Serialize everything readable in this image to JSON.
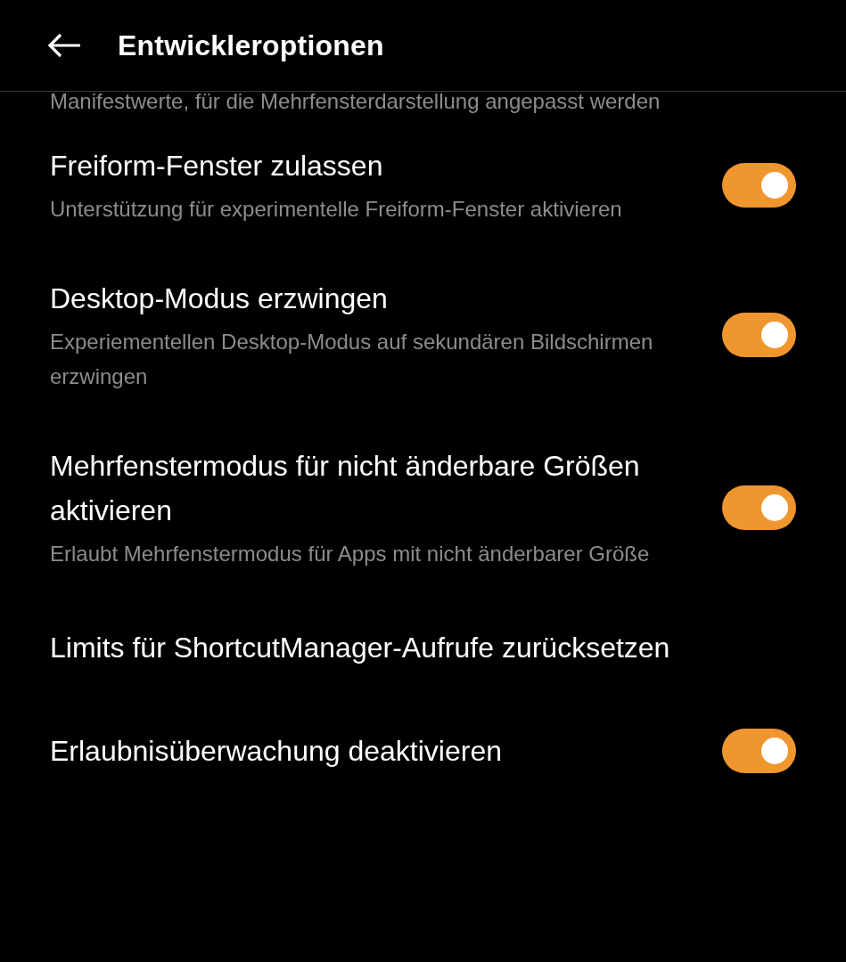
{
  "header": {
    "title": "Entwickleroptionen"
  },
  "partial_summary": "Manifestwerte, für die Mehrfensterdarstellung angepasst werden",
  "items": [
    {
      "kind": "switch",
      "title": "Freiform-Fenster zulassen",
      "summary": "Unterstützung für experimentelle Freiform-Fenster aktivieren",
      "on": true
    },
    {
      "kind": "switch",
      "title": "Desktop-Modus erzwingen",
      "summary": "Experiementellen Desktop-Modus auf sekundären Bildschirmen erzwingen",
      "on": true
    },
    {
      "kind": "switch",
      "title": "Mehrfenstermodus für nicht änderbare Größen aktivieren",
      "summary": "Erlaubt Mehrfenstermodus für Apps mit nicht änderbarer Größe",
      "on": true
    },
    {
      "kind": "action",
      "title": "Limits für ShortcutManager-Aufrufe zurücksetzen"
    },
    {
      "kind": "switch",
      "title": "Erlaubnisüberwachung deaktivieren",
      "on": true
    }
  ]
}
